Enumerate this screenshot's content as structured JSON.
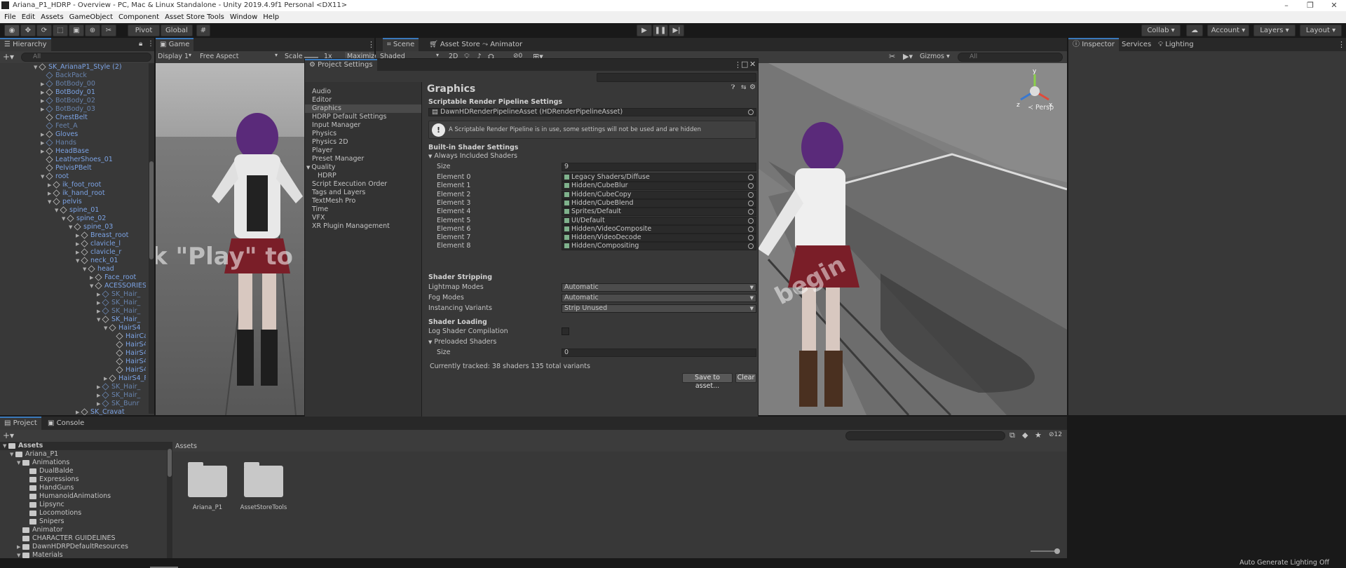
{
  "window": {
    "title": "Ariana_P1_HDRP - Overview - PC, Mac & Linux Standalone - Unity 2019.4.9f1 Personal <DX11>"
  },
  "menu": [
    "File",
    "Edit",
    "Assets",
    "GameObject",
    "Component",
    "Asset Store Tools",
    "Window",
    "Help"
  ],
  "toolbar": {
    "pivot": "Pivot",
    "global": "Global",
    "collab": "Collab",
    "account": "Account",
    "layers": "Layers",
    "layout": "Layout"
  },
  "hierarchy": {
    "tab": "Hierarchy",
    "search": "All",
    "items": [
      {
        "label": "SK_ArianaP1_Style (2)",
        "depth": 0,
        "style": "blue",
        "arrow": "▼"
      },
      {
        "label": "BackPack",
        "depth": 1,
        "style": "dim",
        "arrow": ""
      },
      {
        "label": "BotBody_00",
        "depth": 1,
        "style": "dim",
        "arrow": "▶"
      },
      {
        "label": "BotBody_01",
        "depth": 1,
        "style": "blue",
        "arrow": "▶"
      },
      {
        "label": "BotBody_02",
        "depth": 1,
        "style": "dim",
        "arrow": "▶"
      },
      {
        "label": "BotBody_03",
        "depth": 1,
        "style": "dim",
        "arrow": "▶"
      },
      {
        "label": "ChestBelt",
        "depth": 1,
        "style": "blue",
        "arrow": ""
      },
      {
        "label": "Feet_A",
        "depth": 1,
        "style": "dim",
        "arrow": ""
      },
      {
        "label": "Gloves",
        "depth": 1,
        "style": "blue",
        "arrow": "▶"
      },
      {
        "label": "Hands",
        "depth": 1,
        "style": "dim",
        "arrow": "▶"
      },
      {
        "label": "HeadBase",
        "depth": 1,
        "style": "blue",
        "arrow": "▶"
      },
      {
        "label": "LeatherShoes_01",
        "depth": 1,
        "style": "blue",
        "arrow": ""
      },
      {
        "label": "PelvisPBelt",
        "depth": 1,
        "style": "blue",
        "arrow": ""
      },
      {
        "label": "root",
        "depth": 1,
        "style": "blue",
        "arrow": "▼"
      },
      {
        "label": "ik_foot_root",
        "depth": 2,
        "style": "blue",
        "arrow": "▶"
      },
      {
        "label": "ik_hand_root",
        "depth": 2,
        "style": "blue",
        "arrow": "▶"
      },
      {
        "label": "pelvis",
        "depth": 2,
        "style": "blue",
        "arrow": "▼"
      },
      {
        "label": "spine_01",
        "depth": 3,
        "style": "blue",
        "arrow": "▼"
      },
      {
        "label": "spine_02",
        "depth": 4,
        "style": "blue",
        "arrow": "▼"
      },
      {
        "label": "spine_03",
        "depth": 5,
        "style": "blue",
        "arrow": "▼"
      },
      {
        "label": "Breast_root",
        "depth": 6,
        "style": "blue",
        "arrow": "▶"
      },
      {
        "label": "clavicle_l",
        "depth": 6,
        "style": "blue",
        "arrow": "▶"
      },
      {
        "label": "clavicle_r",
        "depth": 6,
        "style": "blue",
        "arrow": "▶"
      },
      {
        "label": "neck_01",
        "depth": 6,
        "style": "blue",
        "arrow": "▼"
      },
      {
        "label": "head",
        "depth": 7,
        "style": "blue",
        "arrow": "▼"
      },
      {
        "label": "Face_root",
        "depth": 8,
        "style": "blue",
        "arrow": "▶"
      },
      {
        "label": "ACESSORIES",
        "depth": 8,
        "style": "blue",
        "arrow": "▼"
      },
      {
        "label": "SK_Hair_",
        "depth": 9,
        "style": "dim",
        "arrow": "▶"
      },
      {
        "label": "SK_Hair_",
        "depth": 9,
        "style": "dim",
        "arrow": "▶"
      },
      {
        "label": "SK_Hair_",
        "depth": 9,
        "style": "dim",
        "arrow": "▶"
      },
      {
        "label": "SK_Hair_",
        "depth": 9,
        "style": "blue",
        "arrow": "▼"
      },
      {
        "label": "HairS4",
        "depth": 10,
        "style": "blue",
        "arrow": "▼"
      },
      {
        "label": "HairCa",
        "depth": 11,
        "style": "blue",
        "arrow": ""
      },
      {
        "label": "HairS4",
        "depth": 11,
        "style": "blue",
        "arrow": ""
      },
      {
        "label": "HairS4",
        "depth": 11,
        "style": "blue",
        "arrow": ""
      },
      {
        "label": "HairS4",
        "depth": 11,
        "style": "blue",
        "arrow": ""
      },
      {
        "label": "HairS4",
        "depth": 11,
        "style": "blue",
        "arrow": ""
      },
      {
        "label": "HairS4_F",
        "depth": 10,
        "style": "blue",
        "arrow": "▶"
      },
      {
        "label": "SK_Hair_",
        "depth": 9,
        "style": "dim",
        "arrow": "▶"
      },
      {
        "label": "SK_Hair_",
        "depth": 9,
        "style": "dim",
        "arrow": "▶"
      },
      {
        "label": "SK_Bunr",
        "depth": 9,
        "style": "dim",
        "arrow": "▶"
      },
      {
        "label": "SK_Cravat",
        "depth": 6,
        "style": "blue",
        "arrow": "▶"
      }
    ]
  },
  "game": {
    "tab": "Game",
    "display": "Display 1",
    "aspect": "Free Aspect",
    "scale_label": "Scale",
    "scale_value": "1x",
    "maximize": "Maximize",
    "overlay": "k \"Play\" to"
  },
  "scene": {
    "tabs": [
      "Scene",
      "Asset Store",
      "Animator"
    ],
    "shading": "Shaded",
    "mode2d": "2D",
    "gizmos": "Gizmos",
    "search": "All",
    "persp": "Persp",
    "overlay": "begin",
    "hidden_count": "0"
  },
  "inspector": {
    "tabs": [
      "Inspector",
      "Services",
      "Lighting"
    ]
  },
  "project_settings": {
    "title": "Project Settings",
    "categories": [
      {
        "label": "Audio",
        "indent": 0,
        "arrow": ""
      },
      {
        "label": "Editor",
        "indent": 0,
        "arrow": ""
      },
      {
        "label": "Graphics",
        "indent": 0,
        "arrow": "",
        "selected": true
      },
      {
        "label": "HDRP Default Settings",
        "indent": 0,
        "arrow": ""
      },
      {
        "label": "Input Manager",
        "indent": 0,
        "arrow": ""
      },
      {
        "label": "Physics",
        "indent": 0,
        "arrow": ""
      },
      {
        "label": "Physics 2D",
        "indent": 0,
        "arrow": ""
      },
      {
        "label": "Player",
        "indent": 0,
        "arrow": ""
      },
      {
        "label": "Preset Manager",
        "indent": 0,
        "arrow": ""
      },
      {
        "label": "Quality",
        "indent": 0,
        "arrow": "▼"
      },
      {
        "label": "HDRP",
        "indent": 1,
        "arrow": ""
      },
      {
        "label": "Script Execution Order",
        "indent": 0,
        "arrow": ""
      },
      {
        "label": "Tags and Layers",
        "indent": 0,
        "arrow": ""
      },
      {
        "label": "TextMesh Pro",
        "indent": 0,
        "arrow": ""
      },
      {
        "label": "Time",
        "indent": 0,
        "arrow": ""
      },
      {
        "label": "VFX",
        "indent": 0,
        "arrow": ""
      },
      {
        "label": "XR Plugin Management",
        "indent": 0,
        "arrow": ""
      }
    ],
    "graphics": {
      "heading": "Graphics",
      "srp_header": "Scriptable Render Pipeline Settings",
      "srp_asset": "DawnHDRenderPipelineAsset (HDRenderPipelineAsset)",
      "warning": "A Scriptable Render Pipeline is in use, some settings will not be used and are hidden",
      "builtin_header": "Built-in Shader Settings",
      "always_included": "Always Included Shaders",
      "size_label": "Size",
      "size_value": "9",
      "elements": [
        {
          "label": "Element 0",
          "value": "Legacy Shaders/Diffuse"
        },
        {
          "label": "Element 1",
          "value": "Hidden/CubeBlur"
        },
        {
          "label": "Element 2",
          "value": "Hidden/CubeCopy"
        },
        {
          "label": "Element 3",
          "value": "Hidden/CubeBlend"
        },
        {
          "label": "Element 4",
          "value": "Sprites/Default"
        },
        {
          "label": "Element 5",
          "value": "UI/Default"
        },
        {
          "label": "Element 6",
          "value": "Hidden/VideoComposite"
        },
        {
          "label": "Element 7",
          "value": "Hidden/VideoDecode"
        },
        {
          "label": "Element 8",
          "value": "Hidden/Compositing"
        }
      ],
      "stripping_header": "Shader Stripping",
      "lightmap_label": "Lightmap Modes",
      "lightmap_value": "Automatic",
      "fog_label": "Fog Modes",
      "fog_value": "Automatic",
      "instancing_label": "Instancing Variants",
      "instancing_value": "Strip Unused",
      "loading_header": "Shader Loading",
      "log_label": "Log Shader Compilation",
      "preloaded_label": "Preloaded Shaders",
      "preloaded_size_label": "Size",
      "preloaded_size_value": "0",
      "tracked": "Currently tracked: 38 shaders 135 total variants",
      "save_btn": "Save to asset...",
      "clear_btn": "Clear"
    }
  },
  "project": {
    "tabs": [
      "Project",
      "Console"
    ],
    "tree": [
      {
        "label": "Assets",
        "depth": 0,
        "arrow": "▼",
        "bold": true
      },
      {
        "label": "Ariana_P1",
        "depth": 1,
        "arrow": "▼"
      },
      {
        "label": "Animations",
        "depth": 2,
        "arrow": "▼"
      },
      {
        "label": "DualBalde",
        "depth": 3,
        "arrow": ""
      },
      {
        "label": "Expressions",
        "depth": 3,
        "arrow": ""
      },
      {
        "label": "HandGuns",
        "depth": 3,
        "arrow": ""
      },
      {
        "label": "HumanoidAnimations",
        "depth": 3,
        "arrow": ""
      },
      {
        "label": "Lipsync",
        "depth": 3,
        "arrow": ""
      },
      {
        "label": "Locomotions",
        "depth": 3,
        "arrow": ""
      },
      {
        "label": "Snipers",
        "depth": 3,
        "arrow": ""
      },
      {
        "label": "Animator",
        "depth": 2,
        "arrow": ""
      },
      {
        "label": "CHARACTER GUIDELINES",
        "depth": 2,
        "arrow": ""
      },
      {
        "label": "DawnHDRPDefaultResources",
        "depth": 2,
        "arrow": "▶"
      },
      {
        "label": "Materials",
        "depth": 2,
        "arrow": "▼"
      }
    ],
    "breadcrumb": "Assets",
    "folders": [
      "Ariana_P1",
      "AssetStoreTools"
    ],
    "hidden_count": "12"
  },
  "status": {
    "text": "Auto Generate Lighting Off"
  }
}
